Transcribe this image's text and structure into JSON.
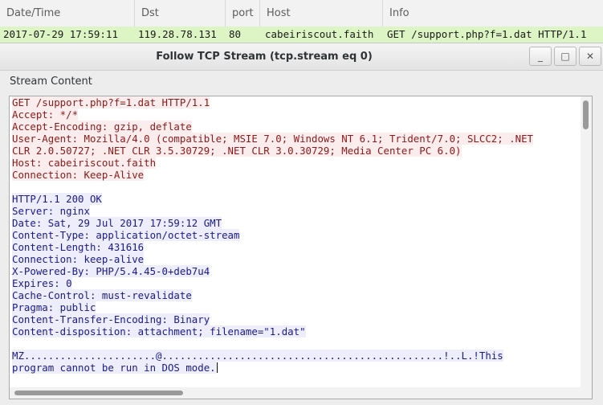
{
  "packet_list": {
    "columns": [
      "Date/Time",
      "Dst",
      "port",
      "Host",
      "Info"
    ],
    "selected_row": {
      "datetime": "2017-07-29 17:59:11",
      "dst": "119.28.78.131",
      "port": "80",
      "host": "cabeiriscout.faith",
      "info": "GET /support.php?f=1.dat HTTP/1.1"
    },
    "selected_color": "#ddf5c4"
  },
  "dialog": {
    "title": "Follow TCP Stream (tcp.stream eq 0)",
    "buttons": {
      "minimize": "_",
      "maximize": "□",
      "close": "✕"
    },
    "stream_label": "Stream Content",
    "client_color": "#8b1a1a",
    "server_color": "#1a1a8b",
    "client_lines": [
      "GET /support.php?f=1.dat HTTP/1.1",
      "Accept: */*",
      "Accept-Encoding: gzip, deflate",
      "User-Agent: Mozilla/4.0 (compatible; MSIE 7.0; Windows NT 6.1; Trident/7.0; SLCC2; .NET",
      "CLR 2.0.50727; .NET CLR 3.5.30729; .NET CLR 3.0.30729; Media Center PC 6.0)",
      "Host: cabeiriscout.faith",
      "Connection: Keep-Alive"
    ],
    "server_lines": [
      "HTTP/1.1 200 OK",
      "Server: nginx",
      "Date: Sat, 29 Jul 2017 17:59:12 GMT",
      "Content-Type: application/octet-stream",
      "Content-Length: 431616",
      "Connection: keep-alive",
      "X-Powered-By: PHP/5.4.45-0+deb7u4",
      "Expires: 0",
      "Cache-Control: must-revalidate",
      "Pragma: public",
      "Content-Transfer-Encoding: Binary",
      "Content-disposition: attachment; filename=\"1.dat\""
    ],
    "binary_lines": [
      "MZ......................@...............................................!..L.!This",
      "program cannot be run in DOS mode."
    ]
  }
}
